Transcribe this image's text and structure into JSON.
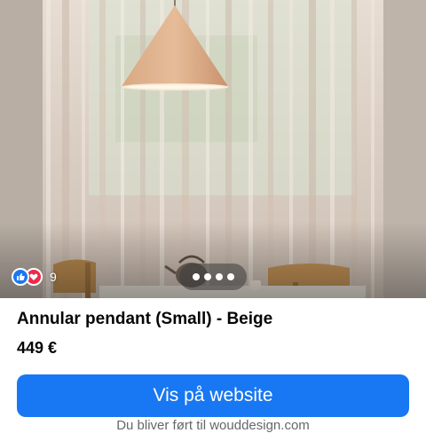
{
  "product": {
    "image_icon": "product-photo-pendant-lamp",
    "title": "Annular pendant (Small) - Beige",
    "price": "449 €"
  },
  "reactions": {
    "icons": [
      "like-icon",
      "love-icon"
    ],
    "count": "9"
  },
  "carousel": {
    "dots": 4
  },
  "cta": {
    "label": "Vis på website",
    "hint": "Du bliver ført til wouddesign.com"
  },
  "colors": {
    "accent": "#1877f2",
    "love": "#f02849",
    "text": "#050505",
    "muted": "#65676b"
  }
}
